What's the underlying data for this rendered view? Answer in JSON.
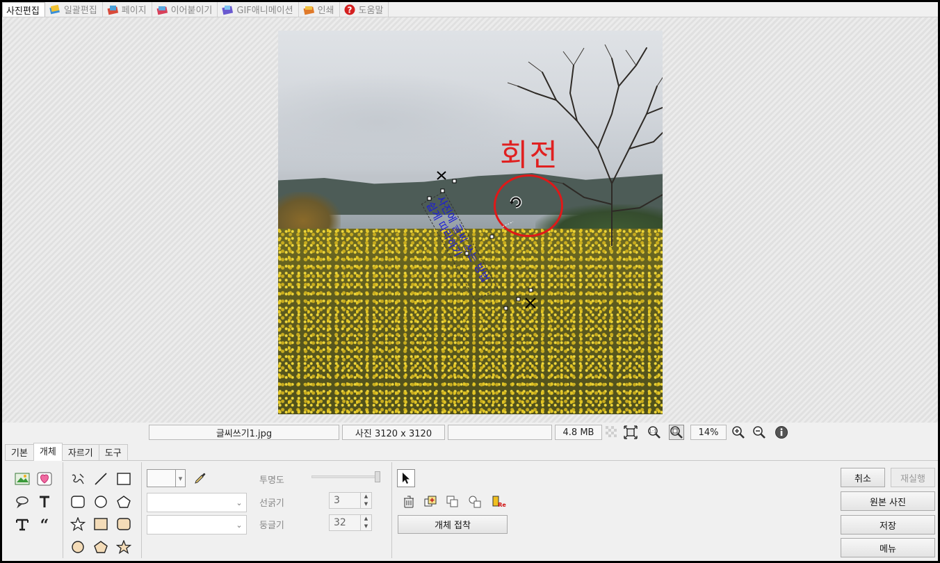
{
  "top_tabs": [
    {
      "label": "사진편집",
      "icon": "photo-edit-icon",
      "active": true
    },
    {
      "label": "일괄편집",
      "icon": "batch-edit-icon",
      "active": false
    },
    {
      "label": "페이지",
      "icon": "page-icon",
      "active": false
    },
    {
      "label": "이어붙이기",
      "icon": "join-icon",
      "active": false
    },
    {
      "label": "GIF애니메이션",
      "icon": "gif-icon",
      "active": false
    },
    {
      "label": "인쇄",
      "icon": "print-icon",
      "active": false
    },
    {
      "label": "도움말",
      "icon": "help-icon",
      "active": false
    }
  ],
  "canvas": {
    "annotation_label": "회전",
    "annotation_color": "#e02020",
    "text_object_line1": "사진에 글씨 쓰는 방법",
    "text_object_line2": "쉽게 따라하기",
    "text_object_color": "#1a1ad8"
  },
  "status": {
    "filename": "글씨쓰기1.jpg",
    "dimensions": "사진 3120 x 3120",
    "empty_field": "",
    "filesize": "4.8 MB",
    "zoom": "14%"
  },
  "panel_tabs": [
    {
      "label": "기본",
      "active": false
    },
    {
      "label": "개체",
      "active": true
    },
    {
      "label": "자르기",
      "active": false
    },
    {
      "label": "도구",
      "active": false
    }
  ],
  "properties": {
    "opacity_label": "투명도",
    "line_width_label": "선굵기",
    "line_width_value": "3",
    "roundness_label": "둥글기",
    "roundness_value": "32"
  },
  "object_tools": {
    "attach_button": "개체 접착"
  },
  "actions": {
    "cancel": "취소",
    "redo": "재실행",
    "original": "원본 사진",
    "save": "저장",
    "menu": "메뉴"
  }
}
